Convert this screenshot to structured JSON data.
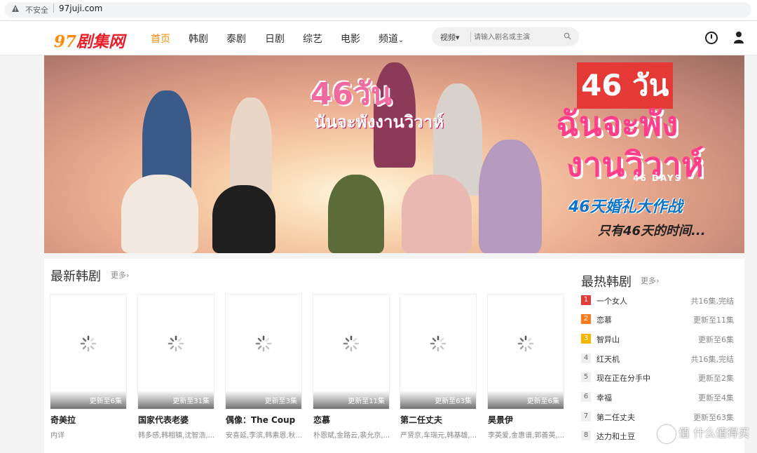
{
  "browser": {
    "security_label": "不安全",
    "url": "97juji.com"
  },
  "nav": {
    "logo_part1": "97",
    "logo_part2": "剧集网",
    "items": [
      "首页",
      "韩剧",
      "泰剧",
      "日剧",
      "综艺",
      "电影",
      "频道"
    ],
    "search": {
      "category": "视频",
      "placeholder": "请输入剧名或主演"
    },
    "colors": {
      "active": "#ff8a00",
      "logo_red": "#e8202a"
    }
  },
  "banner": {
    "thai_title_1": "46วัน",
    "thai_title_2": "นันจะพังงานวิวาห์",
    "thai_big_1": "46 วัน",
    "thai_big_2": "ฉันจะพัง",
    "thai_big_3": "งานวิวาห์",
    "days_label": "46 DAYS",
    "cn_title": "46天婚礼大作战",
    "cn_subtitle": "只有46天的时间..."
  },
  "latest": {
    "title": "最新韩剧",
    "more": "更多›",
    "cards": [
      {
        "update": "更新至6集",
        "title": "奇美拉",
        "desc": "内详"
      },
      {
        "update": "更新至31集",
        "title": "国家代表老婆",
        "desc": "韩多感,韩相镇,沈智浩,..."
      },
      {
        "update": "更新至3集",
        "title": "偶像：The Coup",
        "desc": "安喜延,李滨,韩素恩,秋..."
      },
      {
        "update": "更新至11集",
        "title": "恋慕",
        "desc": "朴恩斌,金路云,裴允京,..."
      },
      {
        "update": "更新至63集",
        "title": "第二任丈夫",
        "desc": "严贤京,车瑞元,韩基雄,..."
      },
      {
        "update": "更新至6集",
        "title": "昊景伊",
        "desc": "李英爱,金惠谱,郭善英,..."
      }
    ]
  },
  "hot": {
    "title": "最热韩剧",
    "more": "更多›",
    "items": [
      {
        "rank": "1",
        "name": "一个女人",
        "status": "共16集,完结"
      },
      {
        "rank": "2",
        "name": "恋慕",
        "status": "更新至11集"
      },
      {
        "rank": "3",
        "name": "智异山",
        "status": "更新至6集"
      },
      {
        "rank": "4",
        "name": "红天机",
        "status": "共16集,完结"
      },
      {
        "rank": "5",
        "name": "现在正在分手中",
        "status": "更新至2集"
      },
      {
        "rank": "6",
        "name": "幸福",
        "status": "更新至4集"
      },
      {
        "rank": "7",
        "name": "第二任丈夫",
        "status": "更新至63集"
      },
      {
        "rank": "8",
        "name": "达力和土豆",
        "status": ""
      }
    ]
  },
  "watermark": "值 什么值得买"
}
